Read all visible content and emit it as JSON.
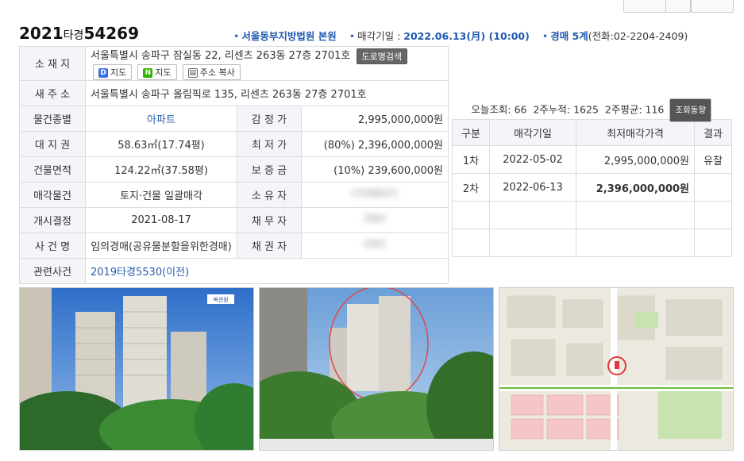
{
  "header": {
    "case_year": "2021",
    "case_type": "타경",
    "case_number": "54269",
    "court": "서울동부지방법원 본원",
    "sale_date_label": "매각기일 : ",
    "sale_date": "2022.06.13(月) (10:00)",
    "division": "경매 5계",
    "phone": "(전화:02-2204-2409)"
  },
  "details": {
    "location_label": "소 재 지",
    "location": "서울특별시 송파구 잠실동 22, 리센츠 263동 27층 2701호",
    "btn_road": "도로명검색",
    "btn_daum_map": "지도",
    "btn_naver_map": "지도",
    "btn_copy": "주소 복사",
    "new_address_label": "새 주 소",
    "new_address": "서울특별시 송파구 올림픽로 135, 리센츠 263동 27층 2701호",
    "type_label": "물건종별",
    "type": "아파트",
    "appraisal_label": "감 정 가",
    "appraisal": "2,995,000,000원",
    "land_label": "대 지 권",
    "land": "58.63㎡(17.74평)",
    "min_label": "최 저 가",
    "min": "(80%) 2,396,000,000원",
    "area_label": "건물면적",
    "area": "124.22㎡(37.58평)",
    "deposit_label": "보 증 금",
    "deposit": "(10%) 239,600,000원",
    "sale_type_label": "매각물건",
    "sale_type": "토지·건물 일괄매각",
    "owner_label": "소 유 자",
    "start_label": "개시결정",
    "start": "2021-08-17",
    "debtor_label": "채 무 자",
    "case_name_label": "사 건 명",
    "case_name": "임의경매(공유물분할을위한경매)",
    "creditor_label": "채 권 자",
    "related_label": "관련사건",
    "related": "2019타경5530(이전)"
  },
  "stats": {
    "today_label": "오늘조회: ",
    "today": "66",
    "two_week_label": "2주누적: ",
    "two_week": "1625",
    "two_week_avg_label": "2주평균: ",
    "two_week_avg": "116",
    "trend_btn": "조회동향"
  },
  "history": {
    "headers": [
      "구분",
      "매각기일",
      "최저매각가격",
      "결과"
    ],
    "rows": [
      {
        "round": "1차",
        "date": "2022-05-02",
        "price": "2,995,000,000원",
        "result": "유찰"
      },
      {
        "round": "2차",
        "date": "2022-06-13",
        "price": "2,396,000,000원",
        "result": ""
      }
    ]
  },
  "colors": {
    "accent": "#1f5ab0",
    "label_bg": "#f3f5f8",
    "border": "#dcdcdc"
  },
  "photos": {
    "badge": "옥션원"
  }
}
